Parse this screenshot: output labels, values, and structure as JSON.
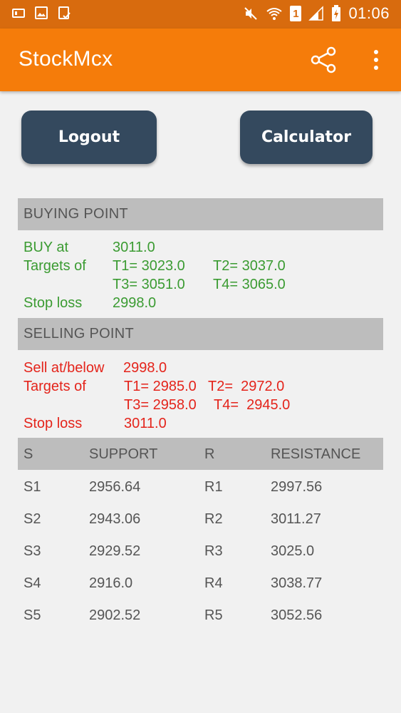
{
  "status_bar": {
    "time": "01:06",
    "sim_badge": "1"
  },
  "app_bar": {
    "title": "StockMcx"
  },
  "buttons": {
    "logout": "Logout",
    "calculator": "Calculator"
  },
  "buying": {
    "header": "BUYING POINT",
    "buy_label": "BUY at",
    "buy_value": "3011.0",
    "targets_label": "Targets of",
    "t1": "T1= 3023.0",
    "t2": "T2= 3037.0",
    "t3": "T3= 3051.0",
    "t4": "T4= 3065.0",
    "stoploss_label": "Stop loss",
    "stoploss_value": "2998.0"
  },
  "selling": {
    "header": "SELLING POINT",
    "sell_label": "Sell at/below",
    "sell_value": "2998.0",
    "targets_label": "Targets of",
    "t1": "T1= 2985.0",
    "t2": "T2=  2972.0",
    "t3": "T3= 2958.0",
    "t4": "T4=  2945.0",
    "stoploss_label": "Stop loss",
    "stoploss_value": "3011.0"
  },
  "sr_table": {
    "headers": [
      "S",
      "SUPPORT",
      "R",
      "RESISTANCE"
    ],
    "rows": [
      [
        "S1",
        "2956.64",
        "R1",
        "2997.56"
      ],
      [
        "S2",
        "2943.06",
        "R2",
        "3011.27"
      ],
      [
        "S3",
        "2929.52",
        "R3",
        "3025.0"
      ],
      [
        "S4",
        "2916.0",
        "R4",
        "3038.77"
      ],
      [
        "S5",
        "2902.52",
        "R5",
        "3052.56"
      ]
    ]
  },
  "colors": {
    "accent": "#f57c0a",
    "status_bar": "#d86b0e",
    "button": "#34495e",
    "buy": "#3b9b32",
    "sell": "#e4241b"
  },
  "icons": [
    "sd-card-icon",
    "image-icon",
    "clipboard-icon",
    "mute-icon",
    "wifi-icon",
    "sim-icon",
    "signal-icon",
    "battery-icon",
    "share-icon",
    "more-vert-icon"
  ]
}
